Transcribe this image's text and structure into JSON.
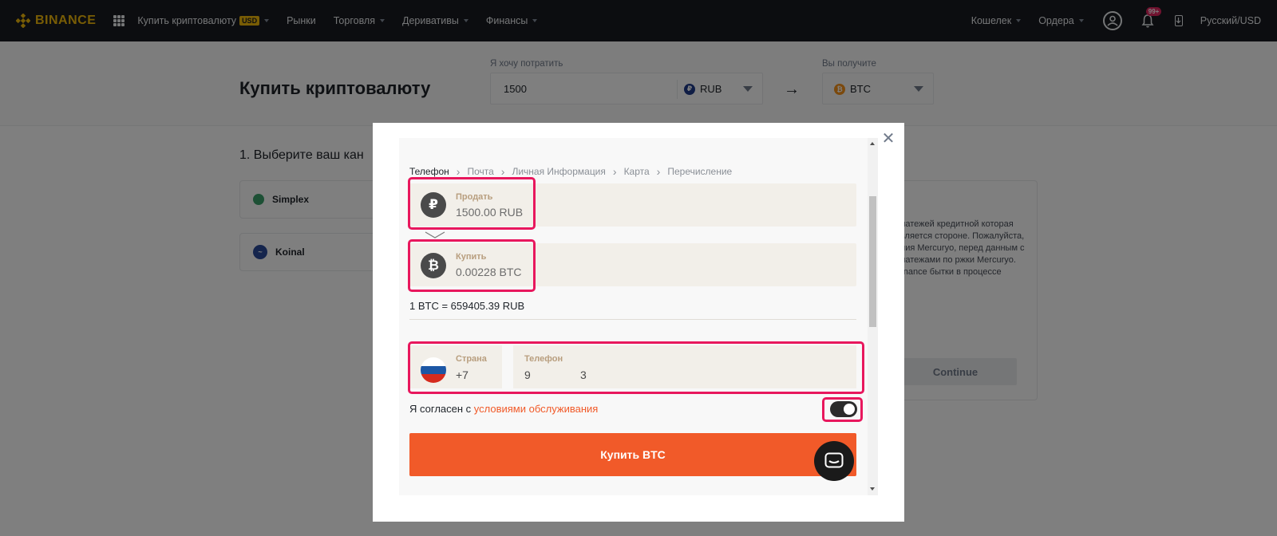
{
  "topnav": {
    "logo_text": "BINANCE",
    "items": [
      {
        "label": "Купить криптовалюту",
        "badge": "USD",
        "dropdown": true
      },
      {
        "label": "Рынки",
        "dropdown": false
      },
      {
        "label": "Торговля",
        "dropdown": true
      },
      {
        "label": "Деривативы",
        "dropdown": true
      },
      {
        "label": "Финансы",
        "dropdown": true
      }
    ],
    "right": {
      "wallet": "Кошелек",
      "orders": "Ордера",
      "notif_count": "99+",
      "lang": "Русский/USD"
    }
  },
  "header": {
    "title": "Купить криптовалюту",
    "spend_label": "Я хочу потратить",
    "spend_value": "1500",
    "spend_currency": "RUB",
    "get_label": "Вы получите",
    "get_currency": "BTC"
  },
  "background": {
    "step_title": "1. Выберите ваш кан",
    "providers": [
      "Simplex",
      "Koinal"
    ],
    "info_text": "платежей кредитной которая является стороне. Пожалуйста, ания Mercuryo, перед данным с платежами по ржки Mercuryo. Binance бытки в процессе",
    "continue": "Continue"
  },
  "modal": {
    "breadcrumbs": [
      "Телефон",
      "Почта",
      "Личная Информация",
      "Карта",
      "Перечисление"
    ],
    "sell": {
      "label": "Продать",
      "value": "1500.00 RUB",
      "icon": "ruble-icon"
    },
    "buy": {
      "label": "Купить",
      "value": "0.00228 BTC",
      "icon": "bitcoin-icon"
    },
    "rate": "1 BTC = 659405.39 RUB",
    "country": {
      "label": "Страна",
      "value": "+7"
    },
    "phone": {
      "label": "Телефон",
      "value": "9                3"
    },
    "agree_text": "Я согласен с ",
    "agree_link": "условиями обслуживания",
    "buy_button": "Купить BTC"
  },
  "colors": {
    "accent": "#f15a29",
    "highlight": "#e8175d",
    "brand": "#f0b90b"
  }
}
